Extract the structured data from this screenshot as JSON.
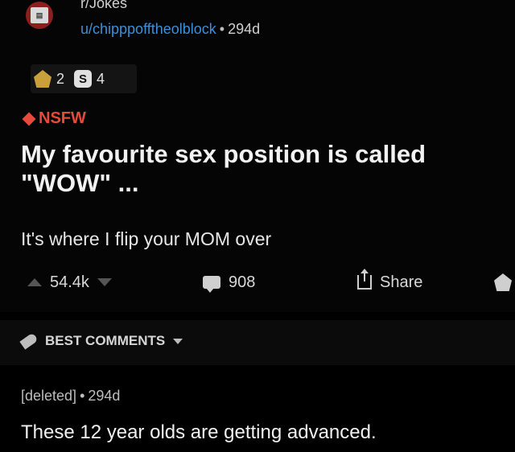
{
  "post": {
    "subreddit": "r/Jokes",
    "user": "u/chipppofftheolblock",
    "separator": "•",
    "age": "294d",
    "awards": [
      {
        "icon": "gold-award-icon",
        "count": "2"
      },
      {
        "icon": "silver-award-icon",
        "glyph": "S",
        "count": "4"
      }
    ],
    "nsfw_label": "NSFW",
    "title": "My favourite sex position is called \"WOW\" ...",
    "body": "It's where I flip your MOM over",
    "votes": "54.4k",
    "comments": "908",
    "share_label": "Share"
  },
  "comments_section": {
    "sort_label": "BEST COMMENTS",
    "items": [
      {
        "author": "[deleted]",
        "separator": "•",
        "age": "294d",
        "body": "These 12 year olds are getting advanced."
      }
    ]
  },
  "colors": {
    "background": "#000000",
    "username": "#3e8fd6",
    "nsfw": "#e54a3a",
    "award_bar": "#e7b21a"
  }
}
